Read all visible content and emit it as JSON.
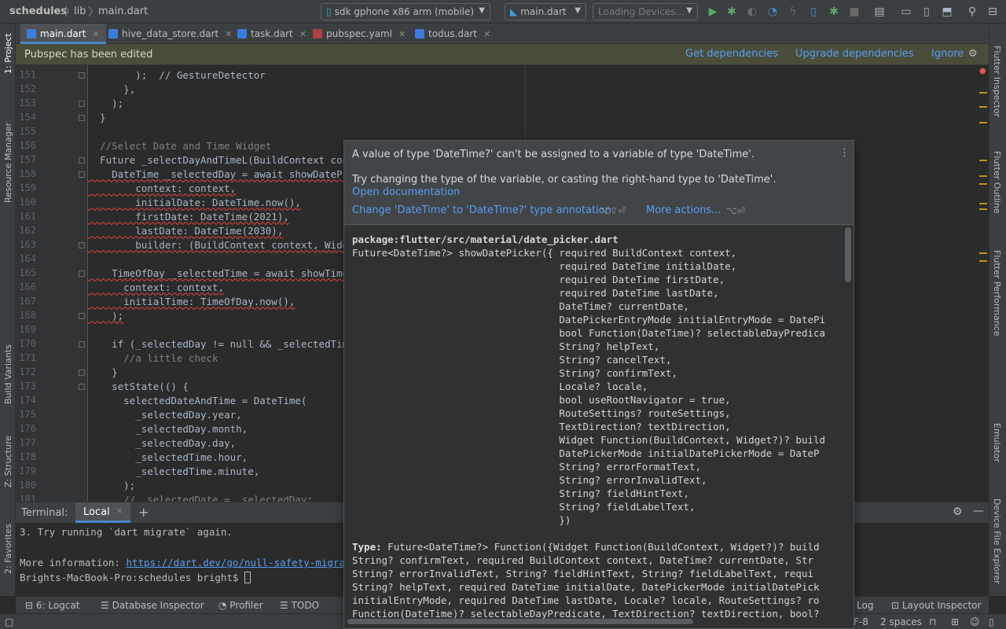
{
  "navbar": {
    "crumbs": [
      "schedules",
      "lib",
      "main.dart"
    ],
    "device_combo": "sdk gphone x86 arm (mobile)",
    "config_combo": "main.dart",
    "devices_combo": "Loading Devices..."
  },
  "tabs": [
    {
      "label": "main.dart",
      "active": true
    },
    {
      "label": "hive_data_store.dart"
    },
    {
      "label": "task.dart"
    },
    {
      "label": "pubspec.yaml"
    },
    {
      "label": "todus.dart"
    }
  ],
  "left_strip": [
    "1: Project",
    "Resource Manager",
    "Build Variants",
    "Z: Structure",
    "2: Favorites"
  ],
  "right_strip": [
    "Flutter Inspector",
    "Flutter Outline",
    "Flutter Performance",
    "Emulator",
    "Device File Explorer"
  ],
  "banner": {
    "message": "Pubspec has been edited",
    "get_dependencies": "Get dependencies",
    "upgrade_dependencies": "Upgrade dependencies",
    "ignore": "Ignore"
  },
  "editor": {
    "line_numbers": [
      "151",
      "152",
      "153",
      "154",
      "155",
      "156",
      "157",
      "158",
      "159",
      "160",
      "161",
      "162",
      "163",
      "164",
      "165",
      "166",
      "167",
      "168",
      "169",
      "170",
      "171",
      "172",
      "173",
      "174",
      "175",
      "176",
      "177",
      "178",
      "179",
      "180",
      "181"
    ],
    "lines": [
      "        );  // GestureDetector",
      "      },",
      "    );",
      "  }",
      "",
      "  //Select Date and Time Widget",
      "  Future _selectDayAndTimeL(BuildContext contex",
      "    DateTime _selectedDay = await showDatePicke",
      "        context: context,",
      "        initialDate: DateTime.now(),",
      "        firstDate: DateTime(2021),",
      "        lastDate: DateTime(2030),",
      "        builder: (BuildContext context, Widget",
      "",
      "    TimeOfDay _selectedTime = await showTimePic",
      "      context: context,",
      "      initialTime: TimeOfDay.now(),",
      "    );",
      "",
      "    if (_selectedDay != null && _selectedTime !",
      "      //a little check",
      "    }",
      "    setState(() {",
      "      selectedDateAndTime = DateTime(",
      "        _selectedDay.year,",
      "        _selectedDay.month,",
      "        _selectedDay.day,",
      "        _selectedTime.hour,",
      "        _selectedTime.minute,",
      "      );",
      "      //  selectedDate = _selectedDay;"
    ]
  },
  "terminal": {
    "title": "Terminal:",
    "tab": "Local",
    "lines": [
      "3. Try running `dart migrate` again.",
      "",
      "More information: ",
      "Brights-MacBook-Pro:schedules bright$ "
    ],
    "link": "https://dart.dev/go/null-safety-migration"
  },
  "bottom_tools": [
    "6: Logcat",
    "Database Inspector",
    "Profiler",
    "TODO",
    "Log",
    "Layout Inspector"
  ],
  "status": {
    "encoding": "F-8",
    "indent": "2 spaces"
  },
  "popup": {
    "error": "A value of type 'DateTime?' can't be assigned to a variable of type 'DateTime'.",
    "hint": "Try changing the type of the variable, or casting the right-hand type to 'DateTime'.",
    "open_docs": "Open documentation",
    "quick_fix": "Change 'DateTime' to 'DateTime?' type annotation",
    "quick_fix_shortcut": "⌥⇧⏎",
    "more_actions": "More actions...",
    "more_actions_shortcut": "⌥⏎",
    "doc_package": "package:flutter/src/material/date_picker.dart",
    "doc_lines": [
      "Future<DateTime?> showDatePicker({ required BuildContext context,",
      "                                   required DateTime initialDate,",
      "                                   required DateTime firstDate,",
      "                                   required DateTime lastDate,",
      "                                   DateTime? currentDate,",
      "                                   DatePickerEntryMode initialEntryMode = DatePi",
      "                                   bool Function(DateTime)? selectableDayPredica",
      "                                   String? helpText,",
      "                                   String? cancelText,",
      "                                   String? confirmText,",
      "                                   Locale? locale,",
      "                                   bool useRootNavigator = true,",
      "                                   RouteSettings? routeSettings,",
      "                                   TextDirection? textDirection,",
      "                                   Widget Function(BuildContext, Widget?)? build",
      "                                   DatePickerMode initialDatePickerMode = DateP",
      "                                   String? errorFormatText,",
      "                                   String? errorInvalidText,",
      "                                   String? fieldHintText,",
      "                                   String? fieldLabelText,",
      "                                   })"
    ],
    "type_label": "Type:",
    "type_lines": [
      " Future<DateTime?> Function({Widget Function(BuildContext, Widget?)? build",
      "String? confirmText, required BuildContext context, DateTime? currentDate, Str",
      "String? errorInvalidText, String? fieldHintText, String? fieldLabelText, requi",
      "String? helpText, required DateTime initialDate, DatePickerMode initialDatePick",
      "initialEntryMode, required DateTime lastDate, Locale? locale, RouteSettings? ro",
      "Function(DateTime)? selectableDayPredicate, TextDirection? textDirection, bool?"
    ]
  },
  "colors": {
    "accent": "#4a88c7",
    "link": "#589df6",
    "error_wave": "#bc3f3c",
    "warning_mark": "#be9117"
  }
}
